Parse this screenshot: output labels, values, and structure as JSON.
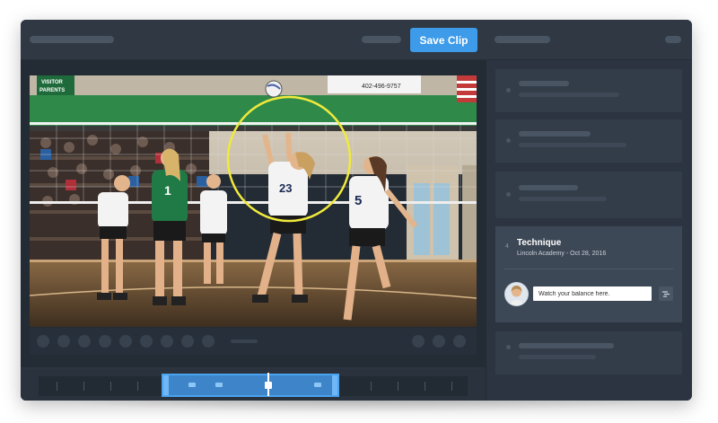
{
  "toolbar": {
    "save_label": "Save Clip"
  },
  "comment": {
    "index": "4",
    "title": "Technique",
    "subtitle": "Lincoln Academy - Oct 28, 2016",
    "input_value": "Watch your balance here."
  },
  "video": {
    "banner_left": "VISITOR\nPARENTS",
    "banner_right": "402-496-9757",
    "jersey_numbers": [
      "1",
      "23",
      "5"
    ]
  },
  "colors": {
    "accent": "#3d9be9",
    "app_bg": "#2b3440",
    "highlight_circle": "#f0ea3c",
    "selection": "#3d84c9"
  },
  "icons": [
    "send-icon",
    "play-control-icons"
  ]
}
